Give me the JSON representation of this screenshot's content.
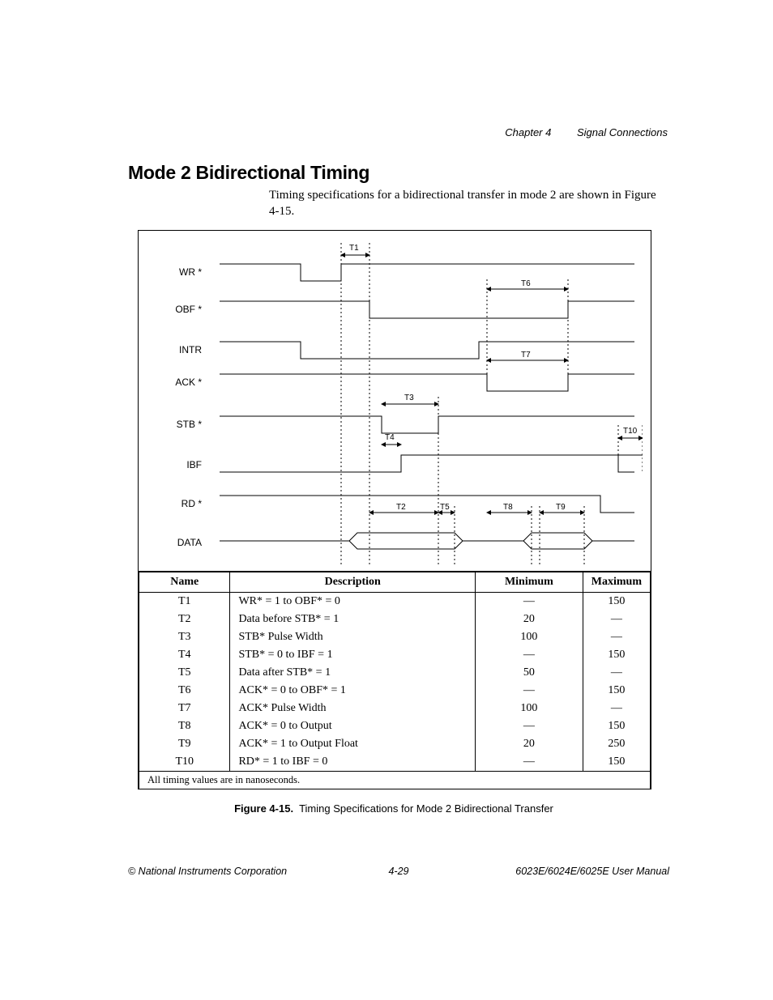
{
  "header": {
    "chapter": "Chapter 4",
    "section": "Signal Connections"
  },
  "title": "Mode 2 Bidirectional Timing",
  "intro": "Timing specifications for a bidirectional transfer in mode 2 are shown in Figure 4-15.",
  "diagram": {
    "signals": [
      "WR *",
      "OBF *",
      "INTR",
      "ACK *",
      "STB *",
      "IBF",
      "RD *",
      "DATA"
    ],
    "markers": [
      "T1",
      "T2",
      "T3",
      "T4",
      "T5",
      "T6",
      "T7",
      "T8",
      "T9",
      "T10"
    ]
  },
  "table": {
    "headers": [
      "Name",
      "Description",
      "Minimum",
      "Maximum"
    ],
    "rows": [
      {
        "name": "T1",
        "desc": "WR* = 1 to OBF* = 0",
        "min": "—",
        "max": "150"
      },
      {
        "name": "T2",
        "desc": "Data before STB* = 1",
        "min": "20",
        "max": "—"
      },
      {
        "name": "T3",
        "desc": "STB* Pulse Width",
        "min": "100",
        "max": "—"
      },
      {
        "name": "T4",
        "desc": "STB* = 0 to IBF = 1",
        "min": "—",
        "max": "150"
      },
      {
        "name": "T5",
        "desc": "Data after STB* = 1",
        "min": "50",
        "max": "—"
      },
      {
        "name": "T6",
        "desc": "ACK* = 0 to OBF* = 1",
        "min": "—",
        "max": "150"
      },
      {
        "name": "T7",
        "desc": "ACK* Pulse Width",
        "min": "100",
        "max": "—"
      },
      {
        "name": "T8",
        "desc": "ACK* = 0 to Output",
        "min": "—",
        "max": "150"
      },
      {
        "name": "T9",
        "desc": "ACK* = 1 to Output Float",
        "min": "20",
        "max": "250"
      },
      {
        "name": "T10",
        "desc": "RD* = 1 to IBF = 0",
        "min": "—",
        "max": "150"
      }
    ],
    "note": "All timing values are in nanoseconds."
  },
  "caption": {
    "label": "Figure 4-15.",
    "text": "Timing Specifications for Mode 2 Bidirectional Transfer"
  },
  "footer": {
    "left": "© National Instruments Corporation",
    "center": "4-29",
    "right": "6023E/6024E/6025E User Manual"
  }
}
